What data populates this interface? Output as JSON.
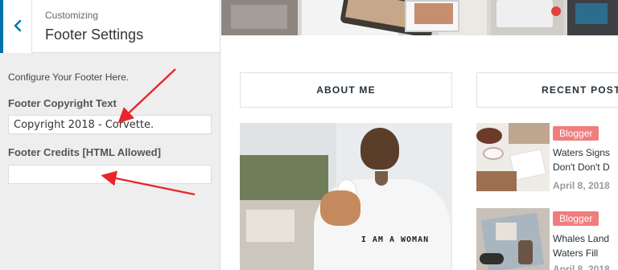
{
  "panel": {
    "back_label": "Back",
    "breadcrumb": "Customizing",
    "title": "Footer Settings",
    "description": "Configure Your Footer Here.",
    "copyright_label": "Footer Copyright Text",
    "copyright_value": "Copyright 2018 - Corvette.",
    "credits_label": "Footer Credits [HTML Allowed]",
    "credits_value": ""
  },
  "preview": {
    "about_widget_title": "ABOUT ME",
    "recent_widget_title": "RECENT POSTS",
    "shirt_text": "I AM A WOMAN",
    "posts": [
      {
        "badge": "Blogger",
        "title_line1": "Waters Signs",
        "title_line2": "Don't Don't D",
        "date": "April 8, 2018"
      },
      {
        "badge": "Blogger",
        "title_line1": "Whales Land",
        "title_line2": "Waters Fill",
        "date": "April 8, 2018"
      }
    ]
  },
  "colors": {
    "accent": "#0073aa",
    "badge": "#f07d7d",
    "arrow": "#e8262b"
  }
}
